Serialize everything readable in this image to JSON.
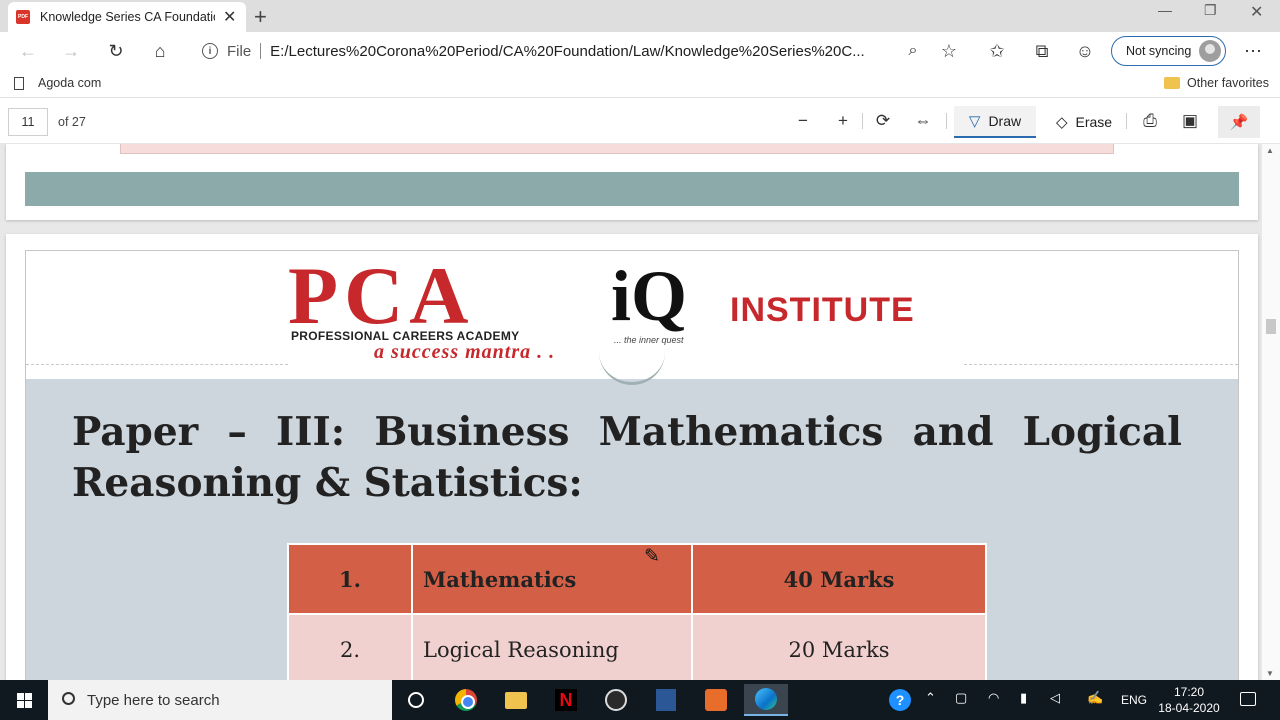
{
  "browser": {
    "tab_title": "Knowledge Series CA Foundation",
    "address": {
      "scheme_label": "File",
      "url": "E:/Lectures%20Corona%20Period/CA%20Foundation/Law/Knowledge%20Series%20C..."
    },
    "sync_label": "Not syncing",
    "favorites": {
      "left_item": "Agoda com",
      "right_item": "Other favorites"
    }
  },
  "pdf_toolbar": {
    "page_number": "11",
    "page_total": "of 27",
    "draw_label": "Draw",
    "erase_label": "Erase"
  },
  "document": {
    "logo": {
      "pca_text": "PCA",
      "pca_subtitle": "PROFESSIONAL CAREERS ACADEMY",
      "pca_tagline": "a success mantra . .",
      "iq_mark": "iQ",
      "iq_institute": "INSTITUTE",
      "iq_tagline": "... the inner quest"
    },
    "heading": "Paper – III: Business Mathematics and Logical Reasoning & Statistics:",
    "table": {
      "rows": [
        {
          "num": "1.",
          "subject": "Mathematics",
          "marks": "40 Marks"
        },
        {
          "num": "2.",
          "subject": "Logical Reasoning",
          "marks": "20 Marks"
        }
      ]
    }
  },
  "taskbar": {
    "search_placeholder": "Type here to search",
    "language": "ENG",
    "time": "17:20",
    "date": "18-04-2020"
  },
  "colors": {
    "table_header": "#d36046",
    "table_row": "#f1d1cf",
    "slide_bg": "#cdd6dd",
    "logo_red": "#c7282c",
    "accent": "#2b6cb0"
  }
}
